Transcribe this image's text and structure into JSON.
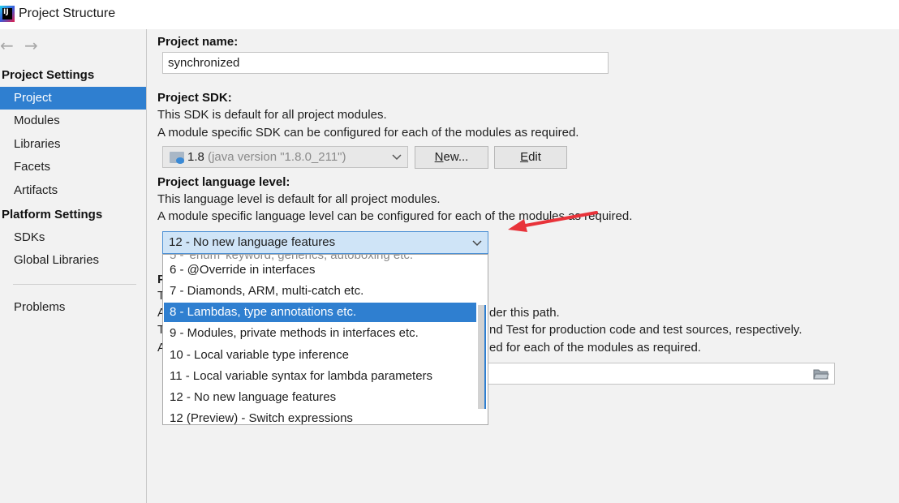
{
  "window": {
    "title": "Project Structure"
  },
  "sidebar": {
    "project_settings_header": "Project Settings",
    "project_items": [
      {
        "label": "Project",
        "selected": true
      },
      {
        "label": "Modules",
        "selected": false
      },
      {
        "label": "Libraries",
        "selected": false
      },
      {
        "label": "Facets",
        "selected": false
      },
      {
        "label": "Artifacts",
        "selected": false
      }
    ],
    "platform_settings_header": "Platform Settings",
    "platform_items": [
      {
        "label": "SDKs"
      },
      {
        "label": "Global Libraries"
      }
    ],
    "problems_label": "Problems"
  },
  "project_name": {
    "label": "Project name:",
    "value": "synchronized"
  },
  "project_sdk": {
    "label": "Project SDK:",
    "desc1": "This SDK is default for all project modules.",
    "desc2": "A module specific SDK can be configured for each of the modules as required.",
    "selected_version": "1.8",
    "selected_detail": "(java version \"1.8.0_211\")",
    "new_button_prefix": "N",
    "new_button_rest": "ew...",
    "edit_button_prefix": "E",
    "edit_button_rest": "dit"
  },
  "language_level": {
    "label": "Project language level:",
    "desc1": "This language level is default for all project modules.",
    "desc2": "A module specific language level can be configured for each of the modules as required.",
    "selected": "12 - No new language features",
    "options": [
      {
        "label": "6 - @Override in interfaces",
        "selected": false
      },
      {
        "label": "7 - Diamonds, ARM, multi-catch etc.",
        "selected": false
      },
      {
        "label": "8 - Lambdas, type annotations etc.",
        "selected": true
      },
      {
        "label": "9 - Modules, private methods in interfaces etc.",
        "selected": false
      },
      {
        "label": "10 - Local variable type inference",
        "selected": false
      },
      {
        "label": "11 - Local variable syntax for lambda parameters",
        "selected": false
      },
      {
        "label": "12 - No new language features",
        "selected": false
      },
      {
        "label": "12 (Preview) - Switch expressions",
        "selected": false
      }
    ]
  },
  "partial_hidden": {
    "line1": "der this path.",
    "line2": "nd Test for production code and test sources, respectively.",
    "line3": "ed for each of the modules as required."
  },
  "colors": {
    "accent": "#2f7fd0",
    "annotation_arrow": "#e8333a"
  }
}
